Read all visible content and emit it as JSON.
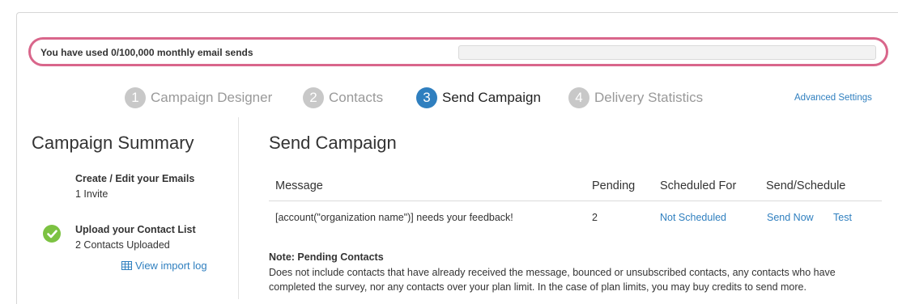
{
  "usage": {
    "text": "You have used 0/100,000 monthly email sends",
    "progress_fraction": 0.0
  },
  "steps": [
    {
      "number": "1",
      "label": "Campaign Designer",
      "active": false
    },
    {
      "number": "2",
      "label": "Contacts",
      "active": false
    },
    {
      "number": "3",
      "label": "Send Campaign",
      "active": true
    },
    {
      "number": "4",
      "label": "Delivery Statistics",
      "active": false
    }
  ],
  "advanced_settings_label": "Advanced Settings",
  "summary": {
    "title": "Campaign Summary",
    "items": [
      {
        "title": "Create / Edit your Emails",
        "subtitle": "1 Invite",
        "completed": false
      },
      {
        "title": "Upload your Contact List",
        "subtitle": "2 Contacts Uploaded",
        "completed": true
      }
    ],
    "import_log_label": "View import log"
  },
  "send": {
    "title": "Send Campaign",
    "columns": [
      "Message",
      "Pending",
      "Scheduled For",
      "Send/Schedule"
    ],
    "row": {
      "message": "[account(\"organization name\")] needs your feedback!",
      "pending": "2",
      "scheduled_for": "Not Scheduled",
      "send_now": "Send Now",
      "test": "Test"
    },
    "note_title": "Note: Pending Contacts",
    "note_text": "Does not include contacts that have already received the message, bounced or unsubscribed contacts, any contacts who have completed the survey, nor any contacts over your plan limit. In the case of plan limits, you may buy credits to send more."
  },
  "colors": {
    "accent": "#2f7fbf",
    "highlight": "#d9668b",
    "success": "#7cc242",
    "inactive_step": "#c8c8c8"
  },
  "icons": {
    "check": "check-icon",
    "grid": "grid-icon"
  }
}
